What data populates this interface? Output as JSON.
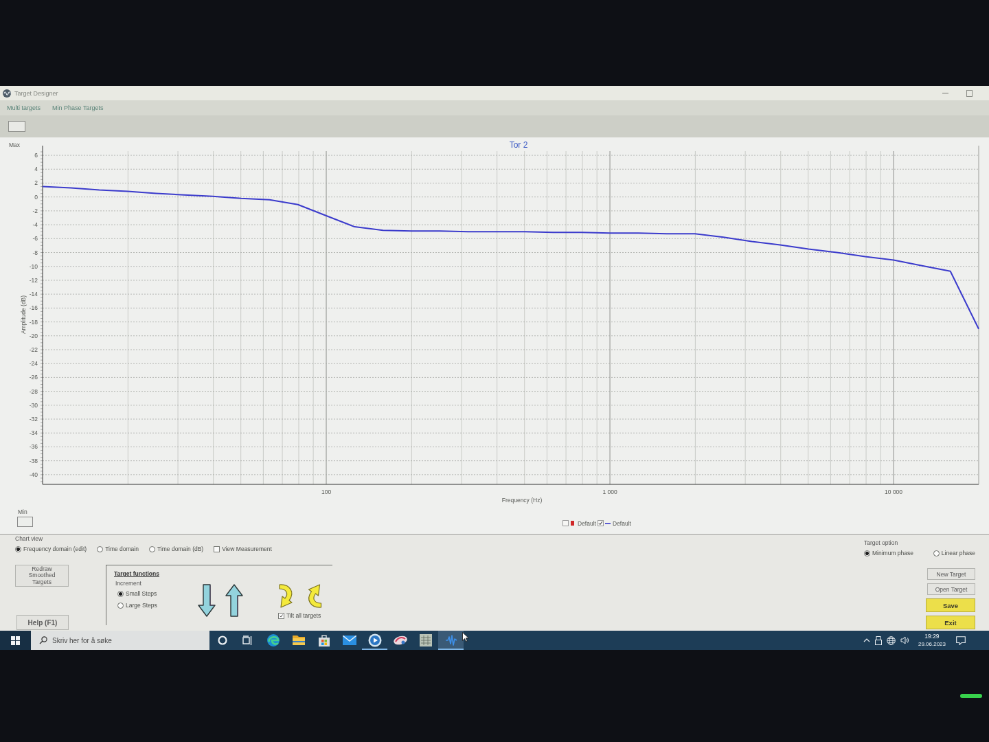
{
  "window": {
    "title": "Target Designer"
  },
  "menu": [
    "Multi targets",
    "Min Phase Targets"
  ],
  "chart_panel": {
    "max_label": "Max",
    "chart_data": {
      "type": "line",
      "title": "Tor 2",
      "xlabel": "Frequency (Hz)",
      "ylabel": "Amplitude (dB)",
      "grid": true,
      "categories": [
        null,
        null,
        null,
        null,
        null,
        null,
        null,
        null,
        null,
        null,
        "100",
        null,
        null,
        null,
        null,
        null,
        null,
        null,
        null,
        null,
        "1 000",
        null,
        null,
        null,
        null,
        null,
        null,
        null,
        null,
        null,
        "10 000",
        null,
        null,
        null
      ],
      "series": [
        {
          "name": "Default",
          "color": "#3b3bcc",
          "values": [
            1.5,
            1.3,
            1.0,
            0.8,
            0.5,
            0.3,
            0.1,
            -0.2,
            -0.4,
            -1.1,
            -2.7,
            -4.3,
            -4.8,
            -4.9,
            -4.9,
            -5.0,
            -5.0,
            -5.0,
            -5.1,
            -5.1,
            -5.2,
            -5.2,
            -5.3,
            -5.3,
            -5.8,
            -6.4,
            -6.9,
            -7.5,
            -8.0,
            -8.6,
            -9.1,
            -9.9,
            -10.7,
            -19
          ]
        }
      ],
      "ylim": [
        -41.4,
        6.6
      ],
      "yticks": [
        6,
        4,
        2,
        0,
        -2,
        -4,
        -6,
        -8,
        -10,
        -12,
        -14,
        -16,
        -18,
        -20,
        -22,
        -24,
        -26,
        -28,
        -30,
        -32,
        -34,
        -36,
        -38,
        -40
      ]
    },
    "min_label": "Min",
    "legend": [
      {
        "label": "Default",
        "checked": false,
        "color": "#d02828",
        "kind": "marker"
      },
      {
        "checked": true,
        "kind": "line"
      }
    ]
  },
  "chart_view": {
    "title": "Chart view",
    "options": [
      {
        "label": "Frequency domain (edit)",
        "selected": true
      },
      {
        "label": "Time domain",
        "selected": false
      },
      {
        "label": "Time domain (dB)",
        "selected": false
      }
    ],
    "view_measurement": {
      "label": "View Measurement",
      "checked": false
    }
  },
  "redraw_button": "Redraw Smoothed Targets",
  "help_button": "Help (F1)",
  "target_functions": {
    "title": "Target functions",
    "increment_label": "Increment",
    "increments": [
      {
        "label": "Small Steps",
        "selected": true
      },
      {
        "label": "Large Steps",
        "selected": false
      }
    ],
    "tilt_all": {
      "label": "Tilt all targets",
      "checked": true
    }
  },
  "target_option": {
    "title": "Target option",
    "options": [
      {
        "label": "Minimum phase",
        "selected": true
      },
      {
        "label": "Linear phase",
        "selected": false
      }
    ]
  },
  "actions": [
    {
      "label": "New Target",
      "kind": "plain"
    },
    {
      "label": "Open Target",
      "kind": "plain"
    },
    {
      "label": "Save",
      "kind": "highlight"
    },
    {
      "label": "Exit",
      "kind": "highlight"
    }
  ],
  "taskbar": {
    "search_placeholder": "Skriv her for å søke",
    "apps": [
      {
        "kind": "ring",
        "open": false,
        "selected": false
      },
      {
        "kind": "task-view",
        "open": false,
        "selected": false
      },
      {
        "kind": "swirl",
        "open": false,
        "selected": false
      },
      {
        "kind": "folder",
        "open": false,
        "selected": false
      },
      {
        "kind": "bag",
        "open": false,
        "selected": false
      },
      {
        "kind": "envelope",
        "open": false,
        "selected": false
      },
      {
        "kind": "play-disc",
        "open": true,
        "selected": false
      },
      {
        "kind": "oval-logo",
        "open": false,
        "selected": false
      },
      {
        "kind": "chart-window",
        "open": false,
        "selected": false
      },
      {
        "kind": "waveform",
        "open": true,
        "selected": true
      }
    ],
    "time": "19:29",
    "date": "29.06.2023"
  }
}
